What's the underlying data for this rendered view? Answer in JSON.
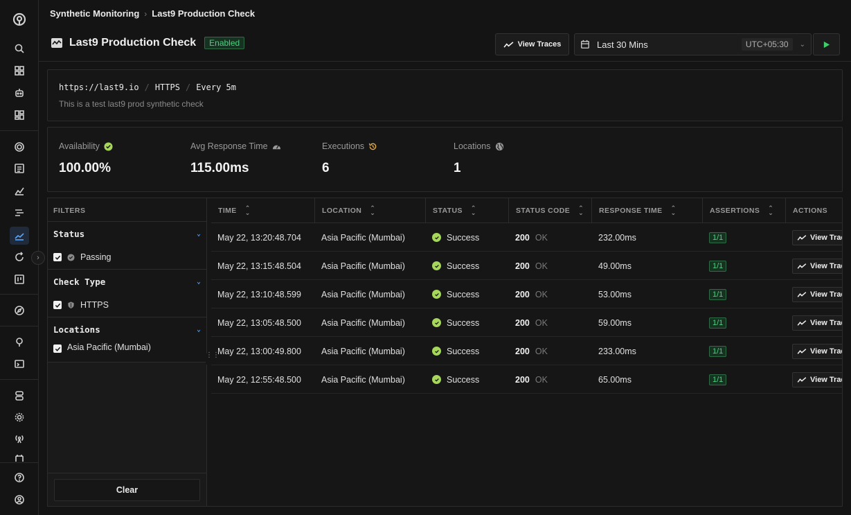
{
  "breadcrumb": {
    "parent": "Synthetic Monitoring",
    "current": "Last9 Production Check"
  },
  "header": {
    "title": "Last9 Production Check",
    "status_badge": "Enabled",
    "view_traces_label": "View Traces",
    "time_range": "Last 30 Mins",
    "timezone": "UTC+05:30"
  },
  "info": {
    "url": "https://last9.io",
    "protocol": "HTTPS",
    "frequency": "Every 5m",
    "description": "This is a test last9 prod synthetic check"
  },
  "stats": {
    "availability": {
      "label": "Availability",
      "value": "100.00%"
    },
    "avg_response": {
      "label": "Avg Response Time",
      "value": "115.00ms"
    },
    "executions": {
      "label": "Executions",
      "value": "6"
    },
    "locations": {
      "label": "Locations",
      "value": "1"
    }
  },
  "filters": {
    "heading": "FILTERS",
    "status": {
      "title": "Status",
      "option": "Passing"
    },
    "check_type": {
      "title": "Check Type",
      "option": "HTTPS"
    },
    "locations": {
      "title": "Locations",
      "option": "Asia Pacific (Mumbai)"
    },
    "clear_label": "Clear"
  },
  "table": {
    "headers": [
      "TIME",
      "LOCATION",
      "STATUS",
      "STATUS CODE",
      "RESPONSE TIME",
      "ASSERTIONS",
      "ACTIONS"
    ],
    "rows": [
      {
        "time": "May 22, 13:20:48.704",
        "location": "Asia Pacific (Mumbai)",
        "status": "Success",
        "code": "200",
        "code_text": "OK",
        "response": "232.00ms",
        "assertions": "1/1",
        "action": "View Trac"
      },
      {
        "time": "May 22, 13:15:48.504",
        "location": "Asia Pacific (Mumbai)",
        "status": "Success",
        "code": "200",
        "code_text": "OK",
        "response": "49.00ms",
        "assertions": "1/1",
        "action": "View Trac"
      },
      {
        "time": "May 22, 13:10:48.599",
        "location": "Asia Pacific (Mumbai)",
        "status": "Success",
        "code": "200",
        "code_text": "OK",
        "response": "53.00ms",
        "assertions": "1/1",
        "action": "View Trac"
      },
      {
        "time": "May 22, 13:05:48.500",
        "location": "Asia Pacific (Mumbai)",
        "status": "Success",
        "code": "200",
        "code_text": "OK",
        "response": "59.00ms",
        "assertions": "1/1",
        "action": "View Trac"
      },
      {
        "time": "May 22, 13:00:49.800",
        "location": "Asia Pacific (Mumbai)",
        "status": "Success",
        "code": "200",
        "code_text": "OK",
        "response": "233.00ms",
        "assertions": "1/1",
        "action": "View Trac"
      },
      {
        "time": "May 22, 12:55:48.500",
        "location": "Asia Pacific (Mumbai)",
        "status": "Success",
        "code": "200",
        "code_text": "OK",
        "response": "65.00ms",
        "assertions": "1/1",
        "action": "View Trac"
      }
    ]
  },
  "colors": {
    "success": "#a6d65a",
    "accent": "#5aa7ff",
    "enabled": "#4fcf7f",
    "run": "#3ecf6a"
  }
}
